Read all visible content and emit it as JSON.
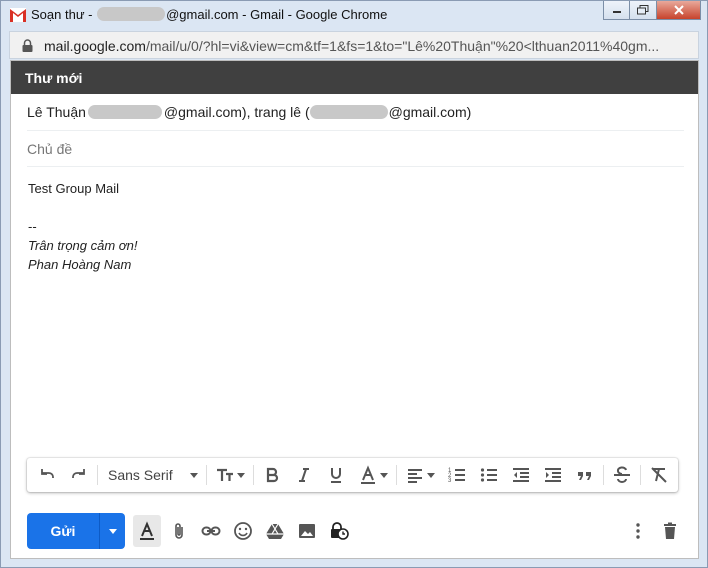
{
  "window": {
    "title_prefix": "Soạn thư - ",
    "title_suffix": "@gmail.com - Gmail - Google Chrome",
    "controls": [
      "minimize",
      "restore",
      "close"
    ]
  },
  "address_bar": {
    "host": "mail.google.com",
    "path": "/mail/u/0/?hl=vi&view=cm&tf=1&fs=1&to=\"Lê%20Thuận\"%20<lthuan2011%40gm..."
  },
  "compose": {
    "header": "Thư mới",
    "to": {
      "recipient1_name": "Lê Thuận",
      "recipient1_suffix": "@gmail.com), trang lê (",
      "recipient2_suffix": "@gmail.com)"
    },
    "subject_placeholder": "Chủ đề",
    "body": {
      "line1": "Test Group Mail",
      "sig_sep": "--",
      "sig_line1": "Trân trọng cảm ơn!",
      "sig_line2": "Phan Hoàng Nam"
    }
  },
  "toolbar": {
    "font": "Sans Serif",
    "icons": [
      "undo-icon",
      "redo-icon",
      "font-size-icon",
      "bold-icon",
      "italic-icon",
      "underline-icon",
      "text-color-icon",
      "align-icon",
      "numbered-list-icon",
      "bulleted-list-icon",
      "indent-less-icon",
      "indent-more-icon",
      "quote-icon",
      "strikethrough-icon",
      "remove-formatting-icon"
    ]
  },
  "bottom": {
    "send_label": "Gửi",
    "icons": [
      "formatting-icon",
      "attach-icon",
      "link-icon",
      "emoji-icon",
      "drive-icon",
      "photo-icon",
      "confidential-icon",
      "more-options-icon",
      "discard-icon"
    ]
  },
  "colors": {
    "header_bg": "#404040",
    "send_blue": "#1a73e8",
    "gmail_red": "#d93025"
  }
}
